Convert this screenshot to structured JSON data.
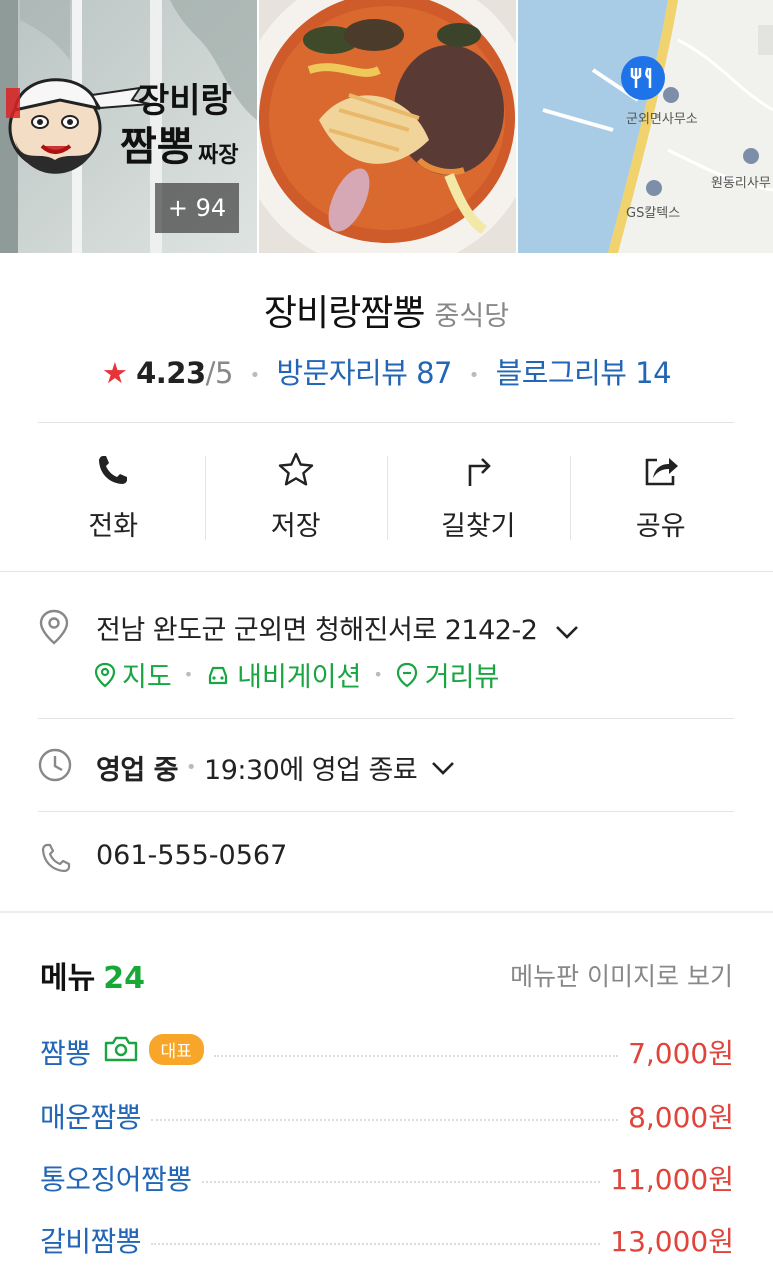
{
  "photos": {
    "more_count": "+ 94",
    "sign_text": [
      "장비랑",
      "짬뽕",
      "짜장"
    ],
    "map_labels": [
      "군외면사무소",
      "원동리사무",
      "GS칼텍스"
    ]
  },
  "place": {
    "name": "장비랑짬뽕",
    "category": "중식당",
    "rating": "4.23",
    "rating_max": "/5",
    "visitor_reviews": "방문자리뷰 87",
    "blog_reviews": "블로그리뷰 14"
  },
  "actions": [
    {
      "label": "전화",
      "icon": "phone-icon"
    },
    {
      "label": "저장",
      "icon": "star-outline-icon"
    },
    {
      "label": "길찾기",
      "icon": "directions-arrow-icon"
    },
    {
      "label": "공유",
      "icon": "share-icon"
    }
  ],
  "address": {
    "text": "전남 완도군 군외면 청해진서로 2142-2",
    "links": {
      "map": "지도",
      "navigation": "내비게이션",
      "street_view": "거리뷰"
    }
  },
  "hours": {
    "status": "영업 중",
    "closing": "19:30에 영업 종료"
  },
  "phone": "061-555-0567",
  "menu": {
    "title": "메뉴",
    "count": "24",
    "view_image_link": "메뉴판 이미지로 보기",
    "items": [
      {
        "name": "짬뽕",
        "price": "7,000원",
        "badge": "대표",
        "has_photo": true
      },
      {
        "name": "매운짬뽕",
        "price": "8,000원"
      },
      {
        "name": "통오징어짬뽕",
        "price": "11,000원"
      },
      {
        "name": "갈비짬뽕",
        "price": "13,000원"
      }
    ]
  },
  "colors": {
    "link_blue": "#2266b5",
    "green": "#19a541",
    "price_red": "#e0443a",
    "star_red": "#e8333a",
    "badge_orange": "#f7a62a",
    "map_pin_blue": "#1e73e8"
  }
}
